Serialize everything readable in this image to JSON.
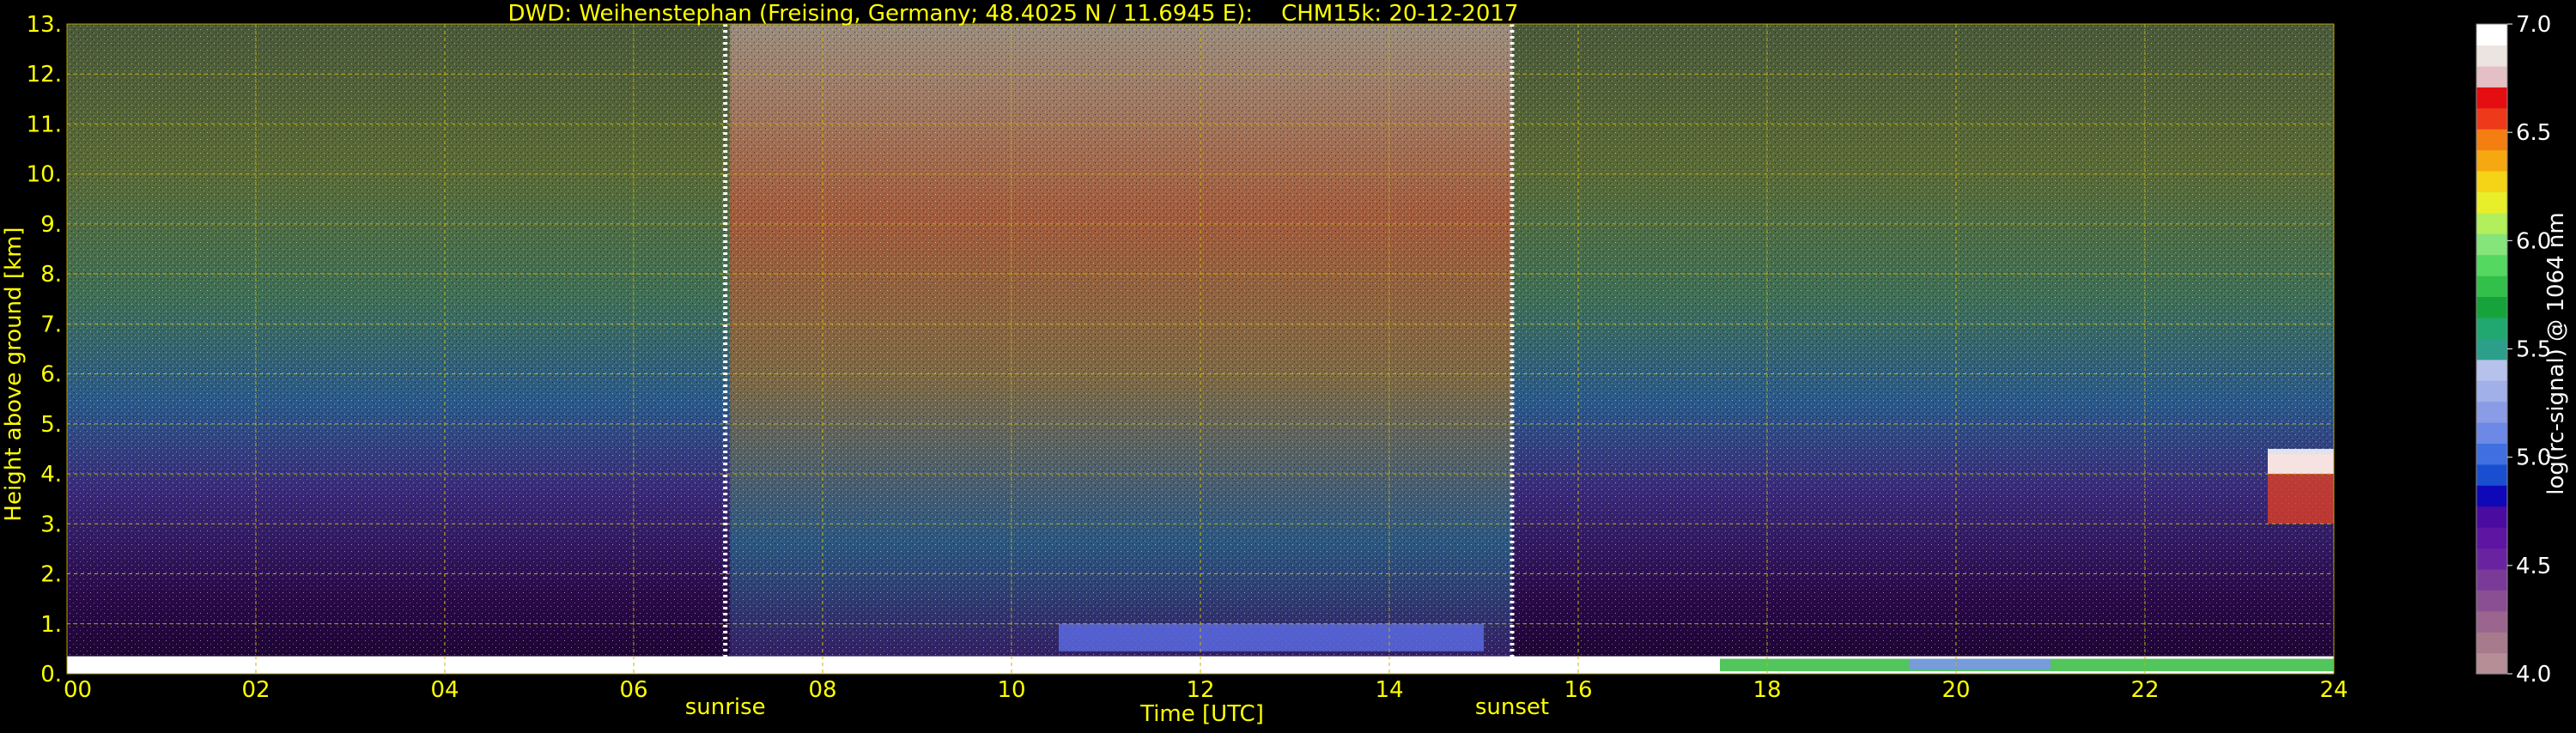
{
  "chart_data": {
    "type": "heatmap",
    "title": "DWD: Weihenstephan (Freising, Germany; 48.4025 N / 11.6945 E):    CHM15k: 20-12-2017",
    "xlabel": "Time [UTC]",
    "ylabel": "Height above ground [km]",
    "xlim": [
      0,
      24
    ],
    "ylim": [
      0,
      13
    ],
    "x_ticks": [
      "00",
      "02",
      "04",
      "06",
      "08",
      "10",
      "12",
      "14",
      "16",
      "18",
      "20",
      "22",
      "24"
    ],
    "y_ticks": [
      "0.",
      "1.",
      "2.",
      "3.",
      "4.",
      "5.",
      "6.",
      "7.",
      "8.",
      "9.",
      "10.",
      "11.",
      "12.",
      "13."
    ],
    "grid": true,
    "events": [
      {
        "label": "sunrise",
        "time": 6.97
      },
      {
        "label": "sunset",
        "time": 15.3
      }
    ],
    "colorbar": {
      "label": "log(rc-signal) @ 1064 nm",
      "range": [
        4.0,
        7.0
      ],
      "ticks": [
        "4.0",
        "4.5",
        "5.0",
        "5.5",
        "6.0",
        "6.5",
        "7.0"
      ],
      "colors": [
        "#b68e96",
        "#a77a8c",
        "#9a6690",
        "#8a4f93",
        "#7a3a98",
        "#6a23a0",
        "#5d15a2",
        "#4a0ba0",
        "#0f08b8",
        "#1a4ed0",
        "#3f6fe0",
        "#6c89e6",
        "#8a9ce6",
        "#a1b0e8",
        "#b7c2ec",
        "#2b9f8a",
        "#20a870",
        "#16a33a",
        "#33c04a",
        "#55d860",
        "#85e57a",
        "#b2ef5a",
        "#e8ef2a",
        "#f5d418",
        "#f6a810",
        "#f57e12",
        "#ee3a1a",
        "#e40e12",
        "#e4c0c4",
        "#ece4e0",
        "#ffffff"
      ]
    }
  }
}
